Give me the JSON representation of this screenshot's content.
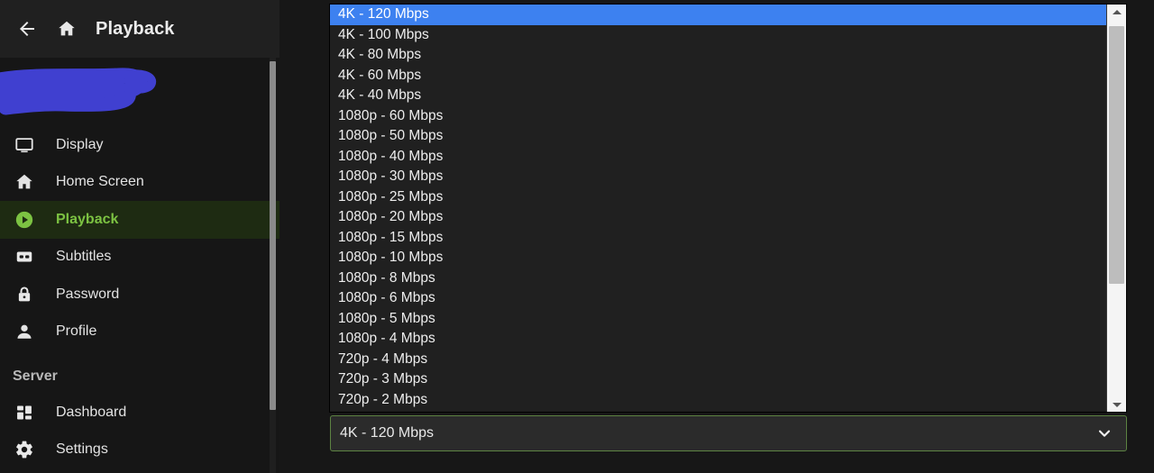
{
  "header": {
    "back_label": "back-arrow",
    "home_label": "home",
    "title": "Playback"
  },
  "sidebar": {
    "logo_redacted": true,
    "items": [
      {
        "label": "Display",
        "icon": "monitor-icon",
        "active": false
      },
      {
        "label": "Home Screen",
        "icon": "home-icon",
        "active": false
      },
      {
        "label": "Playback",
        "icon": "play-circle-icon",
        "active": true
      },
      {
        "label": "Subtitles",
        "icon": "closed-caption-icon",
        "active": false
      },
      {
        "label": "Password",
        "icon": "lock-icon",
        "active": false
      },
      {
        "label": "Profile",
        "icon": "person-icon",
        "active": false
      }
    ],
    "section_title": "Server",
    "server_items": [
      {
        "label": "Dashboard",
        "icon": "grid-icon",
        "active": false
      },
      {
        "label": "Settings",
        "icon": "gear-icon",
        "active": false
      }
    ]
  },
  "select": {
    "value": "4K - 120 Mbps",
    "expanded": true,
    "chevron_icon": "chevron-down-icon",
    "border_color": "#5d8342",
    "highlight_color": "#3d81f0",
    "options": [
      "4K - 120 Mbps",
      "4K - 100 Mbps",
      "4K - 80 Mbps",
      "4K - 60 Mbps",
      "4K - 40 Mbps",
      "1080p - 60 Mbps",
      "1080p - 50 Mbps",
      "1080p - 40 Mbps",
      "1080p - 30 Mbps",
      "1080p - 25 Mbps",
      "1080p - 20 Mbps",
      "1080p - 15 Mbps",
      "1080p - 10 Mbps",
      "1080p - 8 Mbps",
      "1080p - 6 Mbps",
      "1080p - 5 Mbps",
      "1080p - 4 Mbps",
      "720p - 4 Mbps",
      "720p - 3 Mbps",
      "720p - 2 Mbps"
    ],
    "selected_index": 0
  },
  "colors": {
    "accent_green": "#7cc242",
    "active_row_bg": "#1e2b12",
    "page_bg": "#171717",
    "redaction_blue": "#4040d0"
  }
}
